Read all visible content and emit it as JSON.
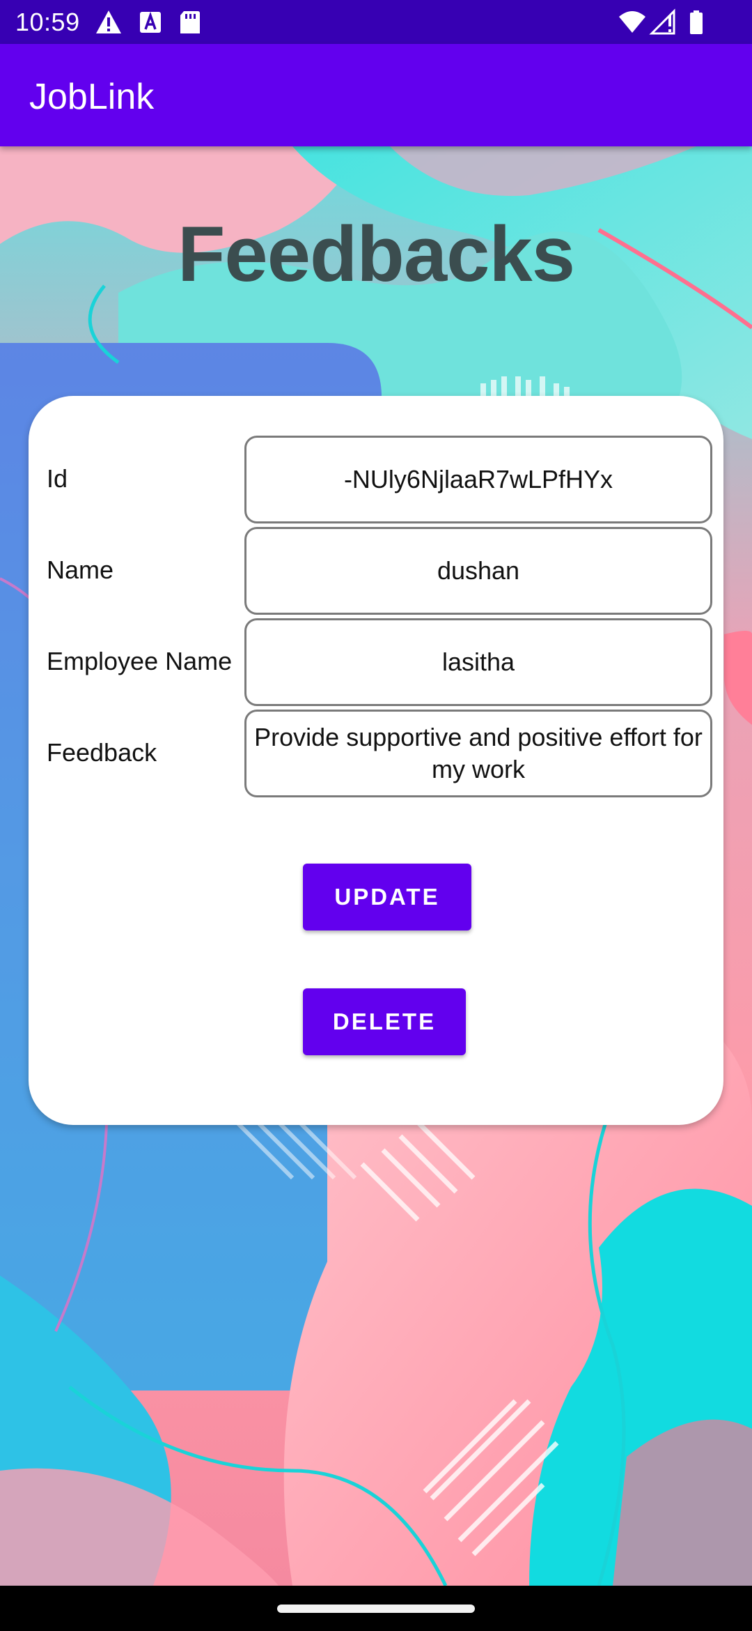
{
  "status_bar": {
    "time": "10:59",
    "icons": [
      "alert-icon",
      "text-a-icon",
      "sd-card-icon",
      "wifi-icon",
      "signal-icon",
      "battery-icon"
    ]
  },
  "app_bar": {
    "title": "JobLink"
  },
  "page": {
    "heading": "Feedbacks"
  },
  "form": {
    "rows": [
      {
        "label": "Id",
        "value": "-NUly6NjlaaR7wLPfHYx"
      },
      {
        "label": "Name",
        "value": "dushan"
      },
      {
        "label": "Employee Name",
        "value": "lasitha"
      },
      {
        "label": "Feedback",
        "value": "Provide supportive and positive effort for my work"
      }
    ]
  },
  "actions": {
    "update_label": "UPDATE",
    "delete_label": "DELETE"
  },
  "colors": {
    "status_bar": "#3700b3",
    "primary": "#6200ee",
    "heading": "#3b4d4f",
    "teal": "#52dcdc",
    "pink": "#ff8fa3",
    "blue": "#3aa4e6"
  }
}
